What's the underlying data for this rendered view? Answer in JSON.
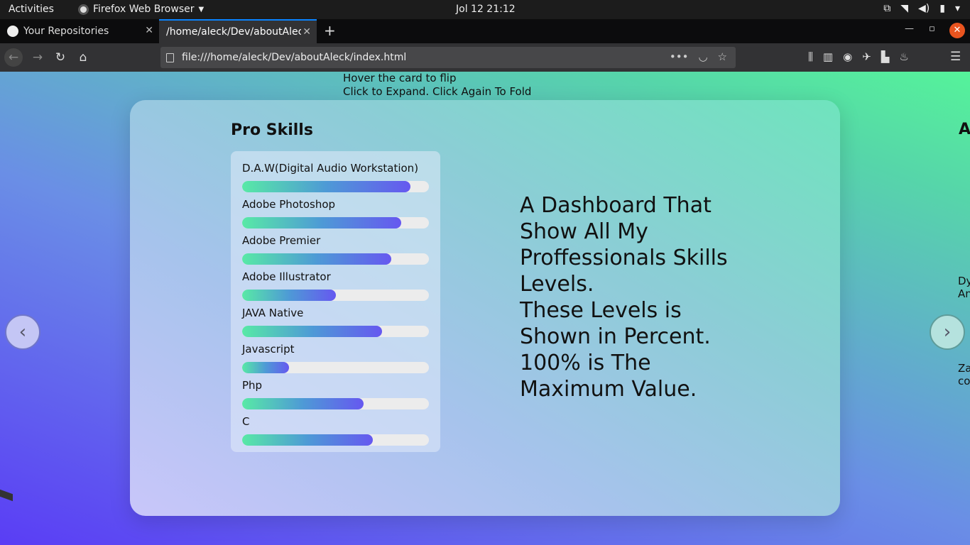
{
  "topbar": {
    "activities": "Activities",
    "app_name": "Firefox Web Browser",
    "clock": "Jol 12  21:12",
    "tray_icons": [
      "screen-icon",
      "wifi-icon",
      "volume-icon",
      "battery-icon",
      "power-icon"
    ]
  },
  "tabs": [
    {
      "title": "Your Repositories",
      "icon": "github-icon",
      "active": false
    },
    {
      "title": "/home/aleck/Dev/aboutAleck",
      "icon": "",
      "active": true
    }
  ],
  "navbar": {
    "url": "file:///home/aleck/Dev/aboutAleck/index.html"
  },
  "page": {
    "hint_line1": "Hover the card to flip",
    "hint_line2": "Click to Expand. Click Again To Fold",
    "card": {
      "title": "Pro Skills",
      "skills": [
        {
          "label": "D.A.W(Digital Audio Workstation)",
          "percent": 90
        },
        {
          "label": "Adobe Photoshop",
          "percent": 85
        },
        {
          "label": "Adobe Premier",
          "percent": 80
        },
        {
          "label": "Adobe Illustrator",
          "percent": 50
        },
        {
          "label": "JAVA Native",
          "percent": 75
        },
        {
          "label": "Javascript",
          "percent": 25
        },
        {
          "label": "Php",
          "percent": 65
        },
        {
          "label": "C",
          "percent": 70
        }
      ],
      "description": [
        "A Dashboard That Show All My Proffessionals Skills Levels.",
        "These Levels is Shown in Percent.",
        "100% is The Maximum Value."
      ]
    },
    "peek": {
      "title": "A",
      "text1_line1": "Dy",
      "text1_line2": "An",
      "text2_line1": "Za",
      "text2_line2": "co"
    },
    "colors": {
      "gradient_start": "#5a3df5",
      "gradient_end": "#55f39a",
      "bar_start": "#58e9a6",
      "bar_end": "#6658f0"
    }
  }
}
